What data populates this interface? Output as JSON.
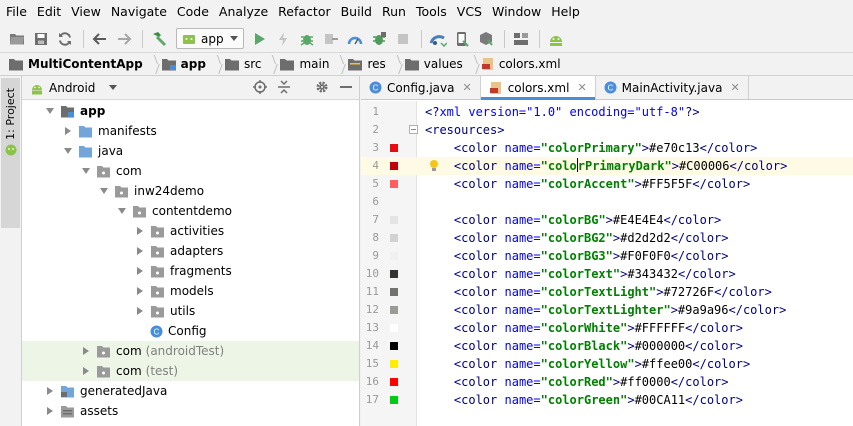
{
  "menu": [
    "File",
    "Edit",
    "View",
    "Navigate",
    "Code",
    "Analyze",
    "Refactor",
    "Build",
    "Run",
    "Tools",
    "VCS",
    "Window",
    "Help"
  ],
  "toolbar": {
    "run_config": "app"
  },
  "breadcrumb": [
    "MultiContentApp",
    "app",
    "src",
    "main",
    "res",
    "values",
    "colors.xml"
  ],
  "toolstrip": {
    "project_tab": "1: Project"
  },
  "project_panel": {
    "view": "Android",
    "tree": [
      {
        "label": "app",
        "sub": "",
        "bold": true
      },
      {
        "label": "manifests",
        "sub": ""
      },
      {
        "label": "java",
        "sub": ""
      },
      {
        "label": "com",
        "sub": ""
      },
      {
        "label": "inw24demo",
        "sub": ""
      },
      {
        "label": "contentdemo",
        "sub": ""
      },
      {
        "label": "activities",
        "sub": ""
      },
      {
        "label": "adapters",
        "sub": ""
      },
      {
        "label": "fragments",
        "sub": ""
      },
      {
        "label": "models",
        "sub": ""
      },
      {
        "label": "utils",
        "sub": ""
      },
      {
        "label": "Config",
        "sub": ""
      },
      {
        "label": "com",
        "sub": "(androidTest)"
      },
      {
        "label": "com",
        "sub": "(test)"
      },
      {
        "label": "generatedJava",
        "sub": ""
      },
      {
        "label": "assets",
        "sub": ""
      }
    ]
  },
  "editor": {
    "tabs": [
      "Config.java",
      "colors.xml",
      "MainActivity.java"
    ],
    "active_tab": "colors.xml",
    "current_line": 4,
    "lines": [
      {
        "n": "1",
        "parts": [
          "<?",
          "xml version=\"1.0\" encoding=\"utf-8\"",
          "?>"
        ]
      },
      {
        "n": "2",
        "tag_text": "<resources>"
      },
      {
        "n": "3",
        "name": "colorPrimary",
        "value": "#e70c13",
        "swatch": "#e70c13"
      },
      {
        "n": "4",
        "name": "colorPrimaryDark",
        "value": "#C00006",
        "swatch": "#C00006"
      },
      {
        "n": "5",
        "name": "colorAccent",
        "value": "#FF5F5F",
        "swatch": "#FF5F5F"
      },
      {
        "n": "6"
      },
      {
        "n": "7",
        "name": "colorBG",
        "value": "#E4E4E4",
        "swatch": "#E4E4E4"
      },
      {
        "n": "8",
        "name": "colorBG2",
        "value": "#d2d2d2",
        "swatch": "#d2d2d2"
      },
      {
        "n": "9",
        "name": "colorBG3",
        "value": "#F0F0F0",
        "swatch": "#F0F0F0"
      },
      {
        "n": "10",
        "name": "colorText",
        "value": "#343432",
        "swatch": "#343432"
      },
      {
        "n": "11",
        "name": "colorTextLight",
        "value": "#72726F",
        "swatch": "#72726F"
      },
      {
        "n": "12",
        "name": "colorTextLighter",
        "value": "#9a9a96",
        "swatch": "#9a9a96"
      },
      {
        "n": "13",
        "name": "colorWhite",
        "value": "#FFFFFF",
        "swatch": "#FFFFFF"
      },
      {
        "n": "14",
        "name": "colorBlack",
        "value": "#000000",
        "swatch": "#000000"
      },
      {
        "n": "15",
        "name": "colorYellow",
        "value": "#ffee00",
        "swatch": "#ffee00"
      },
      {
        "n": "16",
        "name": "colorRed",
        "value": "#ff0000",
        "swatch": "#ff0000"
      },
      {
        "n": "17",
        "name": "colorGreen",
        "value": "#00CA11",
        "swatch": "#00CA11"
      }
    ]
  },
  "colors": {
    "tab_underline": "#4a8ed8",
    "run_green": "#59a869",
    "folder_blue": "#74a5d9",
    "android_green": "#8cc34a"
  }
}
